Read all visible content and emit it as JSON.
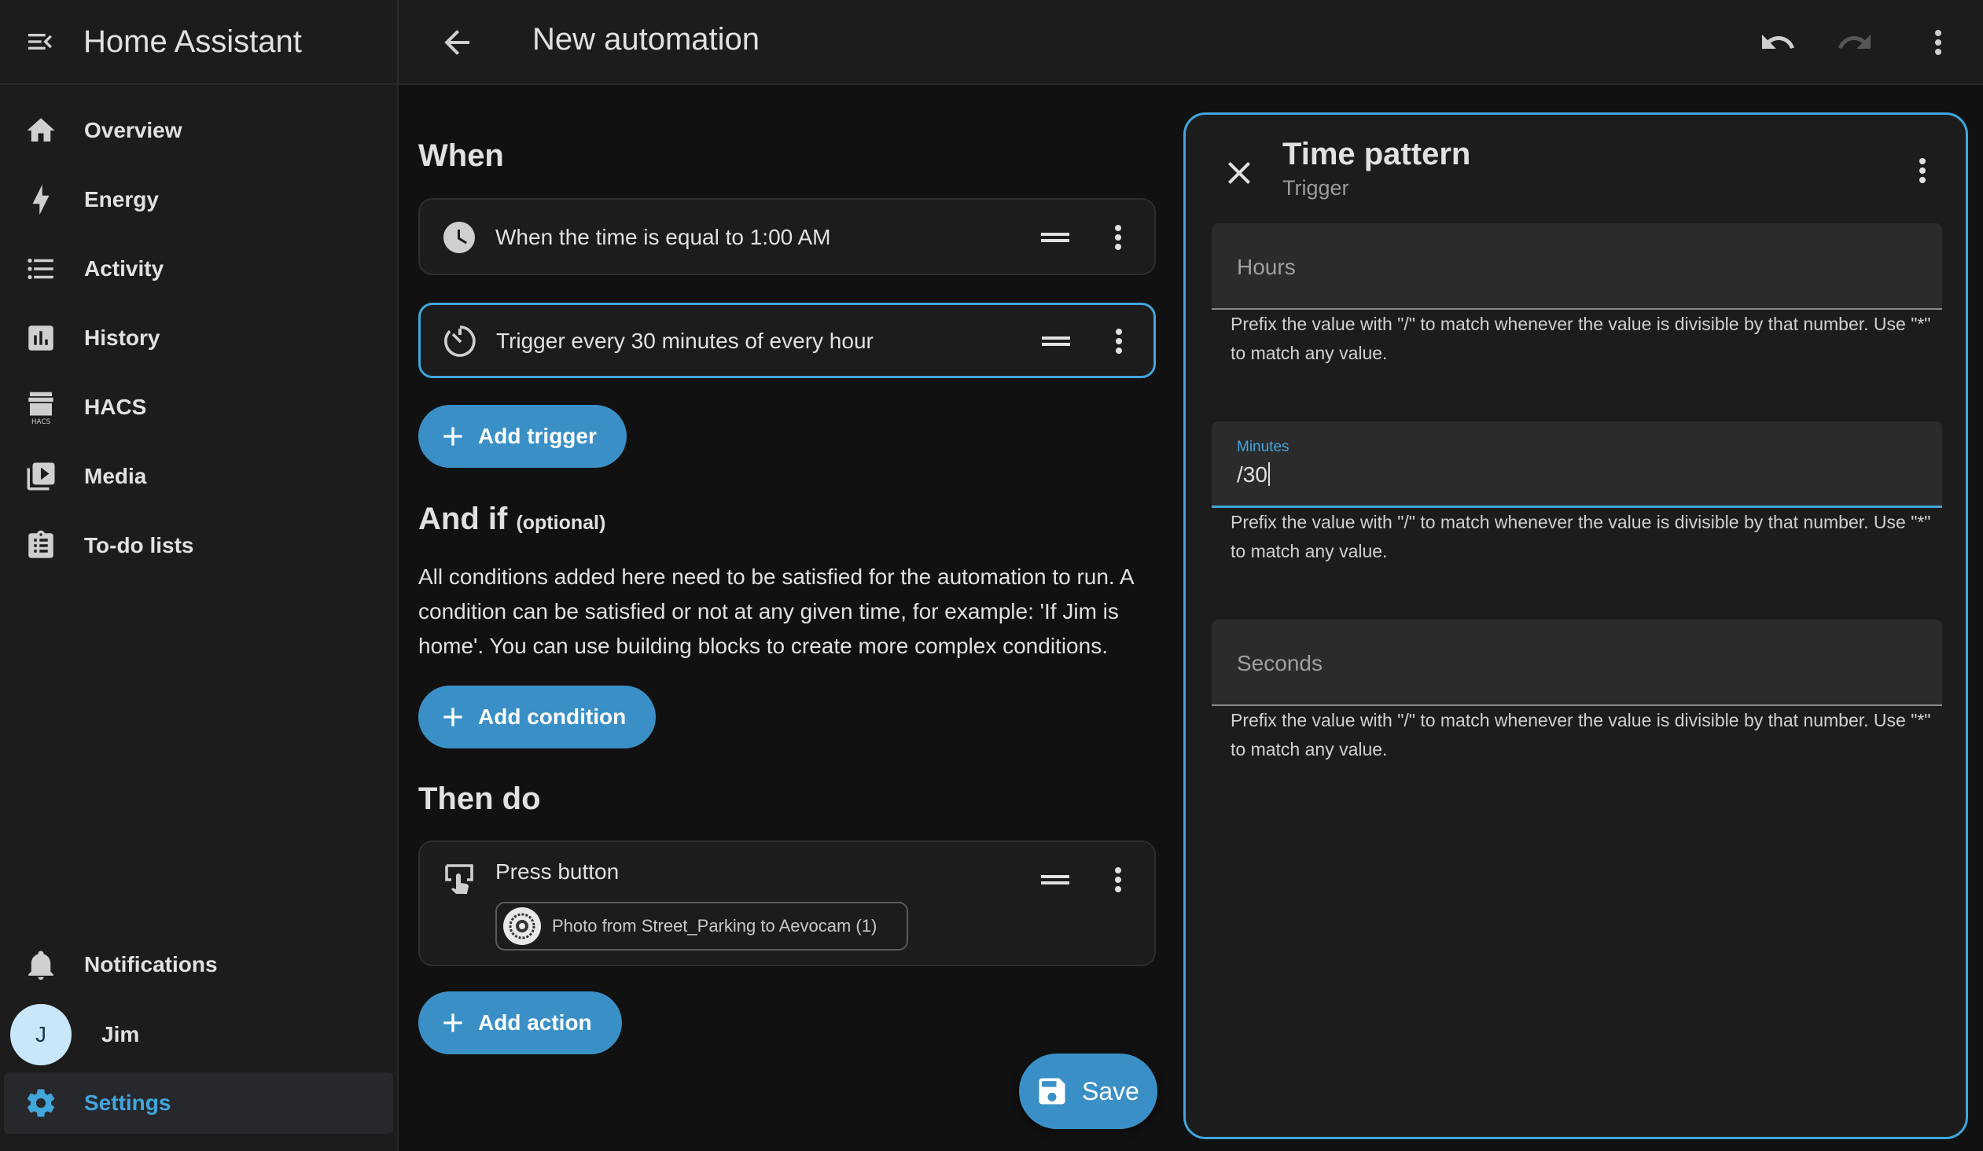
{
  "app": {
    "title": "Home Assistant"
  },
  "sidebar": {
    "items": [
      {
        "label": "Overview",
        "icon": "home-icon"
      },
      {
        "label": "Energy",
        "icon": "lightning-bolt-icon"
      },
      {
        "label": "Activity",
        "icon": "format-list-icon"
      },
      {
        "label": "History",
        "icon": "chart-box-icon"
      },
      {
        "label": "HACS",
        "icon": "hacs-icon"
      },
      {
        "label": "Media",
        "icon": "play-box-multiple-icon"
      },
      {
        "label": "To-do lists",
        "icon": "clipboard-list-icon"
      }
    ],
    "notifications": "Notifications",
    "user": {
      "initial": "J",
      "name": "Jim"
    },
    "settings": "Settings"
  },
  "topbar": {
    "title": "New automation"
  },
  "when": {
    "title": "When",
    "triggers": [
      {
        "text": "When the time is equal to 1:00 AM",
        "icon": "clock-icon"
      },
      {
        "text": "Trigger every 30 minutes of every hour",
        "icon": "timer-outline-icon"
      }
    ],
    "add_label": "Add trigger"
  },
  "and_if": {
    "title": "And if",
    "optional": "(optional)",
    "description": "All conditions added here need to be satisfied for the automation to run. A condition can be satisfied or not at any given time, for example: 'If Jim is home'. You can use building blocks to create more complex conditions.",
    "add_label": "Add condition"
  },
  "then_do": {
    "title": "Then do",
    "action": {
      "text": "Press button",
      "icon": "gesture-tap-button-icon",
      "target": "Photo from Street_Parking to Aevocam (1)"
    },
    "add_label": "Add action"
  },
  "save_label": "Save",
  "pane": {
    "title": "Time pattern",
    "subtitle": "Trigger",
    "fields": [
      {
        "label": "Hours",
        "value": ""
      },
      {
        "label": "Minutes",
        "value": "/30"
      },
      {
        "label": "Seconds",
        "value": ""
      }
    ],
    "helper": "Prefix the value with \"/\" to match whenever the value is divisible by that number. Use \"*\" to match any value."
  },
  "colors": {
    "accent": "#41a6dc",
    "button": "#3a90c6",
    "background": "#111111",
    "surface": "#1c1c1c"
  }
}
